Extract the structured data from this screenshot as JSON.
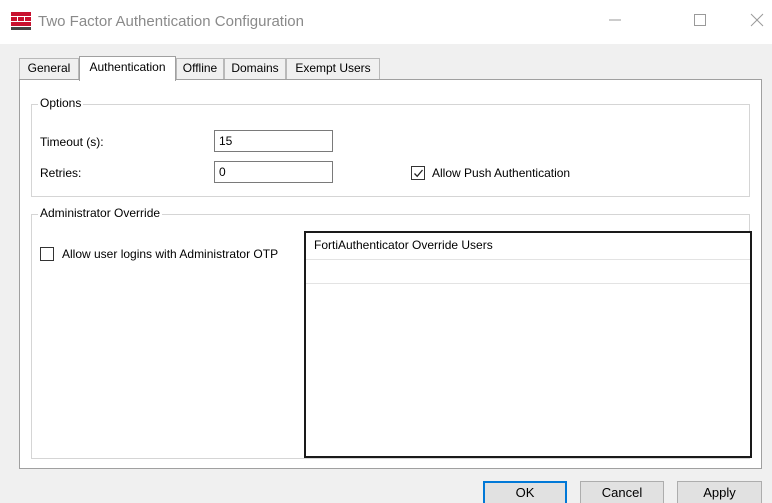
{
  "window": {
    "title": "Two Factor Authentication Configuration",
    "icon": "fortinet-logo-icon"
  },
  "tabs": [
    {
      "label": "General",
      "active": false
    },
    {
      "label": "Authentication",
      "active": true
    },
    {
      "label": "Offline",
      "active": false
    },
    {
      "label": "Domains",
      "active": false
    },
    {
      "label": "Exempt Users",
      "active": false
    }
  ],
  "options": {
    "legend": "Options",
    "timeout_label": "Timeout (s):",
    "timeout_value": "15",
    "retries_label": "Retries:",
    "retries_value": "0",
    "allow_push_label": "Allow Push Authentication",
    "allow_push_checked": true
  },
  "admin_override": {
    "legend": "Administrator Override",
    "allow_admin_otp_label": "Allow user logins with Administrator OTP",
    "allow_admin_otp_checked": false,
    "users_list_header": "FortiAuthenticator Override Users"
  },
  "buttons": {
    "ok": "OK",
    "cancel": "Cancel",
    "apply": "Apply"
  },
  "colors": {
    "brand_red": "#c8102e",
    "default_button_border": "#0078d7",
    "title_text": "#8a8a8a"
  }
}
